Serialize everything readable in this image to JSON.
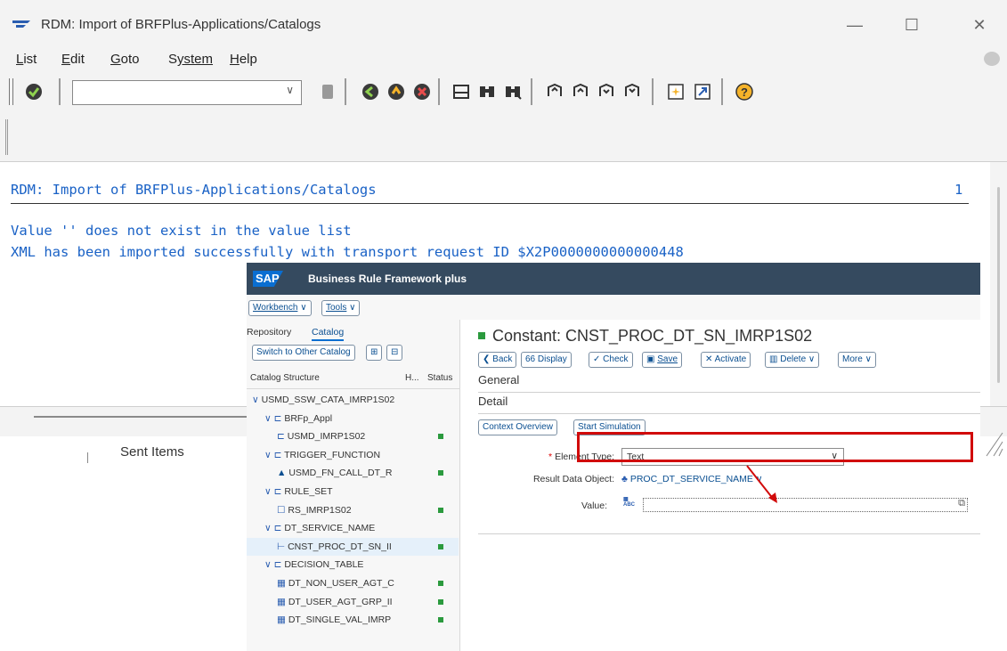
{
  "window": {
    "title": "RDM: Import of BRFPlus-Applications/Catalogs",
    "minimize": "—",
    "maximize": "☐",
    "close": "✕"
  },
  "menu": {
    "items": [
      {
        "key": "L",
        "rest": "ist"
      },
      {
        "key": "E",
        "rest": "dit"
      },
      {
        "key": "G",
        "rest": "oto"
      },
      {
        "key": "S",
        "rest": "ystem",
        "prefix": "S",
        "underline_char": "y"
      },
      {
        "key": "H",
        "rest": "elp"
      }
    ]
  },
  "toolbar": {
    "command_value": "",
    "dropdown_caret": "∨"
  },
  "report": {
    "header": "RDM: Import of BRFPlus-Applications/Catalogs",
    "page_number": "1",
    "line1": "Value '' does not exist in the value list",
    "line2": "XML has been imported successfully with transport request ID $X2P0000000000000448",
    "tab_label": "Sent Items"
  },
  "brf": {
    "logo": "SAP",
    "app_title": "Business Rule Framework plus",
    "workbench_label": "Workbench",
    "tools_label": "Tools",
    "tabs": {
      "repository": "Repository",
      "catalog": "Catalog"
    },
    "switch_catalog": "Switch to Other Catalog",
    "columns": {
      "structure": "Catalog Structure",
      "h": "H...",
      "status": "Status"
    },
    "tree": [
      {
        "label": "USMD_SSW_CATA_IMRP1S02",
        "indent": 0,
        "type": "root",
        "status": false
      },
      {
        "label": "BRFp_Appl",
        "indent": 1,
        "type": "folder",
        "status": false
      },
      {
        "label": "USMD_IMRP1S02",
        "indent": 2,
        "type": "app",
        "status": true
      },
      {
        "label": "TRIGGER_FUNCTION",
        "indent": 1,
        "type": "folder",
        "status": false
      },
      {
        "label": "USMD_FN_CALL_DT_R",
        "indent": 2,
        "type": "function",
        "status": true
      },
      {
        "label": "RULE_SET",
        "indent": 1,
        "type": "folder",
        "status": false
      },
      {
        "label": "RS_IMRP1S02",
        "indent": 2,
        "type": "ruleset",
        "status": true
      },
      {
        "label": "DT_SERVICE_NAME",
        "indent": 1,
        "type": "folder",
        "status": false
      },
      {
        "label": "CNST_PROC_DT_SN_II",
        "indent": 2,
        "type": "constant",
        "status": true,
        "selected": true
      },
      {
        "label": "DECISION_TABLE",
        "indent": 1,
        "type": "folder",
        "status": false
      },
      {
        "label": "DT_NON_USER_AGT_C",
        "indent": 2,
        "type": "table",
        "status": true
      },
      {
        "label": "DT_USER_AGT_GRP_II",
        "indent": 2,
        "type": "table",
        "status": true
      },
      {
        "label": "DT_SINGLE_VAL_IMRP",
        "indent": 2,
        "type": "table",
        "status": true
      }
    ],
    "constant_title": "Constant: CNST_PROC_DT_SN_IMRP1S02",
    "actions": {
      "back": "Back",
      "display": "Display",
      "check": "Check",
      "save": "Save",
      "activate": "Activate",
      "delete": "Delete",
      "more": "More"
    },
    "sections": {
      "general": "General",
      "detail": "Detail"
    },
    "buttons": {
      "context_overview": "Context Overview",
      "start_simulation": "Start Simulation"
    },
    "form": {
      "element_type_label": "Element Type:",
      "element_type_value": "Text",
      "result_object_label": "Result Data Object:",
      "result_object_value": "PROC_DT_SERVICE_NAME",
      "value_label": "Value:",
      "value_value": "",
      "abc_badge": "ABC"
    },
    "colors": {
      "header": "#354a5f",
      "accent": "#0a6ed1",
      "status_ok": "#2b9a3e",
      "highlight": "#d10a0a"
    }
  }
}
